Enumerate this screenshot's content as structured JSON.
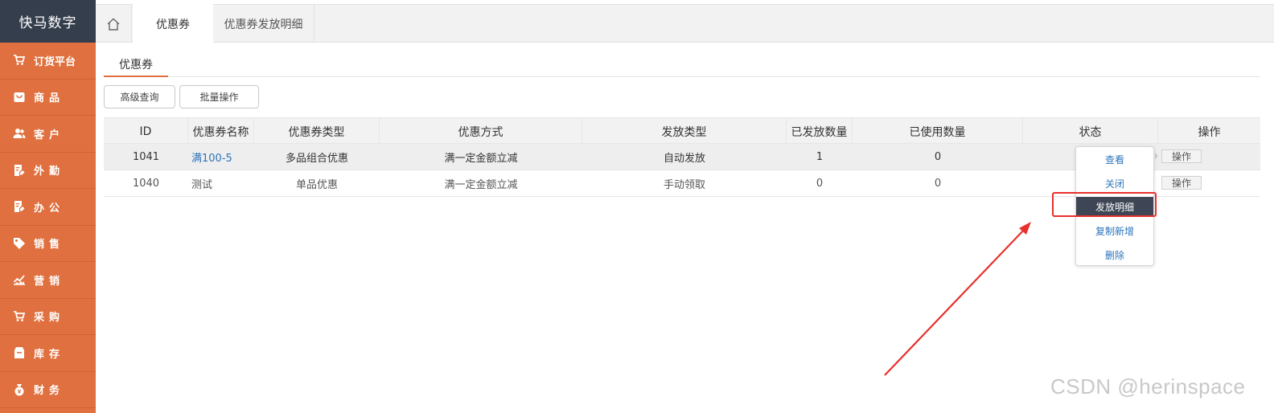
{
  "brand": "快马数字",
  "sidebar": {
    "items": [
      {
        "label": "订货平台",
        "icon": "cart-icon"
      },
      {
        "label": "商品",
        "icon": "bag-icon"
      },
      {
        "label": "客户",
        "icon": "users-icon"
      },
      {
        "label": "外勤",
        "icon": "clipboard-icon"
      },
      {
        "label": "办公",
        "icon": "clipboard-icon"
      },
      {
        "label": "销售",
        "icon": "tag-icon"
      },
      {
        "label": "营销",
        "icon": "trend-icon"
      },
      {
        "label": "采购",
        "icon": "cart-icon"
      },
      {
        "label": "库存",
        "icon": "box-icon"
      },
      {
        "label": "财务",
        "icon": "money-bag-icon"
      }
    ]
  },
  "tabs": {
    "active": "优惠券",
    "other": "优惠券发放明细"
  },
  "subtab": "优惠券",
  "toolbar": {
    "advanced_query": "高级查询",
    "batch_ops": "批量操作"
  },
  "table": {
    "headers": [
      "ID",
      "优惠券名称",
      "优惠券类型",
      "优惠方式",
      "发放类型",
      "已发放数量",
      "已使用数量",
      "状态",
      "操作"
    ],
    "rows": [
      {
        "id": "1041",
        "name": "满100-5",
        "type": "多品组合优惠",
        "method": "满一定金额立减",
        "issue_type": "自动发放",
        "issued": "1",
        "used": "0",
        "status": "",
        "op": "操作"
      },
      {
        "id": "1040",
        "name": "测试",
        "type": "单品优惠",
        "method": "满一定金额立减",
        "issue_type": "手动领取",
        "issued": "0",
        "used": "0",
        "status": "",
        "op": "操作"
      }
    ]
  },
  "dropdown": {
    "items": [
      "查看",
      "关闭",
      "发放明细",
      "复制新增",
      "删除"
    ],
    "active_index": 2
  },
  "watermark": "CSDN @herinspace",
  "colors": {
    "sidebar": "#e0703f",
    "brand_bg": "#343e4c",
    "link": "#2c75bb",
    "highlight": "#e8302c"
  }
}
